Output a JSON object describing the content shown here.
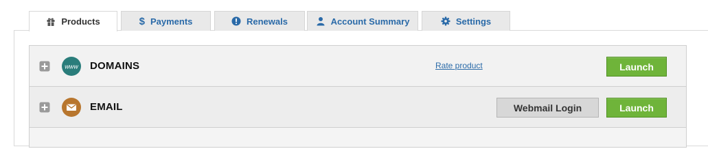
{
  "tabs": [
    {
      "label": "Products",
      "icon": "gift-icon",
      "active": true
    },
    {
      "label": "Payments",
      "icon": "dollar-icon",
      "active": false
    },
    {
      "label": "Renewals",
      "icon": "alert-icon",
      "active": false
    },
    {
      "label": "Account Summary",
      "icon": "user-icon",
      "active": false
    },
    {
      "label": "Settings",
      "icon": "gear-icon",
      "active": false
    }
  ],
  "products": [
    {
      "name": "DOMAINS",
      "icon": "www-icon",
      "rate_label": "Rate product",
      "launch_label": "Launch"
    },
    {
      "name": "EMAIL",
      "icon": "envelope-icon",
      "webmail_label": "Webmail Login",
      "launch_label": "Launch"
    }
  ],
  "colors": {
    "link": "#2a6aa8",
    "launch": "#6fb43a",
    "domains_icon": "#2a7d7b",
    "email_icon": "#b8762e"
  }
}
